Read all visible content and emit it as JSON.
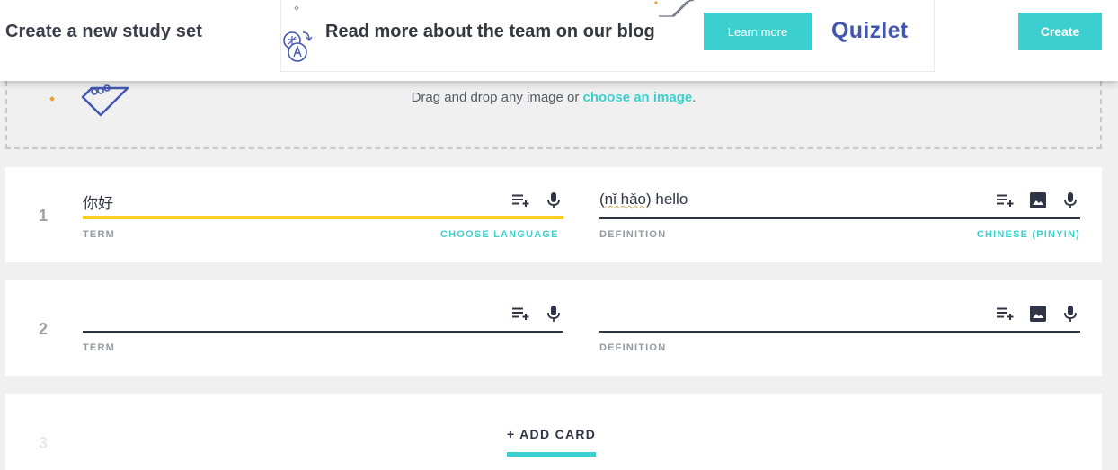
{
  "header": {
    "title": "Create a new study set",
    "create_label": "Create"
  },
  "banner": {
    "text": "Read more about the team on our blog",
    "button_label": "Learn more",
    "logo": "Quizlet"
  },
  "image_drop": {
    "text": "Drag and drop any image or",
    "link": "choose an image",
    "suffix": "."
  },
  "cards": [
    {
      "number": "1",
      "term": "你好",
      "definition_pinyin": "(nǐ hǎo)",
      "definition_rest": " hello",
      "term_label": "TERM",
      "definition_label": "DEFINITION",
      "term_language": "CHOOSE LANGUAGE",
      "definition_language": "CHINESE (PINYIN)"
    },
    {
      "number": "2",
      "term": "",
      "definition": "",
      "term_label": "TERM",
      "definition_label": "DEFINITION"
    }
  ],
  "add_card": {
    "number": "3",
    "label": "+ ADD CARD"
  },
  "colors": {
    "accent": "#3ccfcf",
    "brand": "#4257b2",
    "active_underline": "#ffcd1f",
    "text": "#303545"
  },
  "icons": [
    "image-illustration-icon",
    "add-list-icon",
    "microphone-icon",
    "image-icon",
    "pen-icon"
  ]
}
